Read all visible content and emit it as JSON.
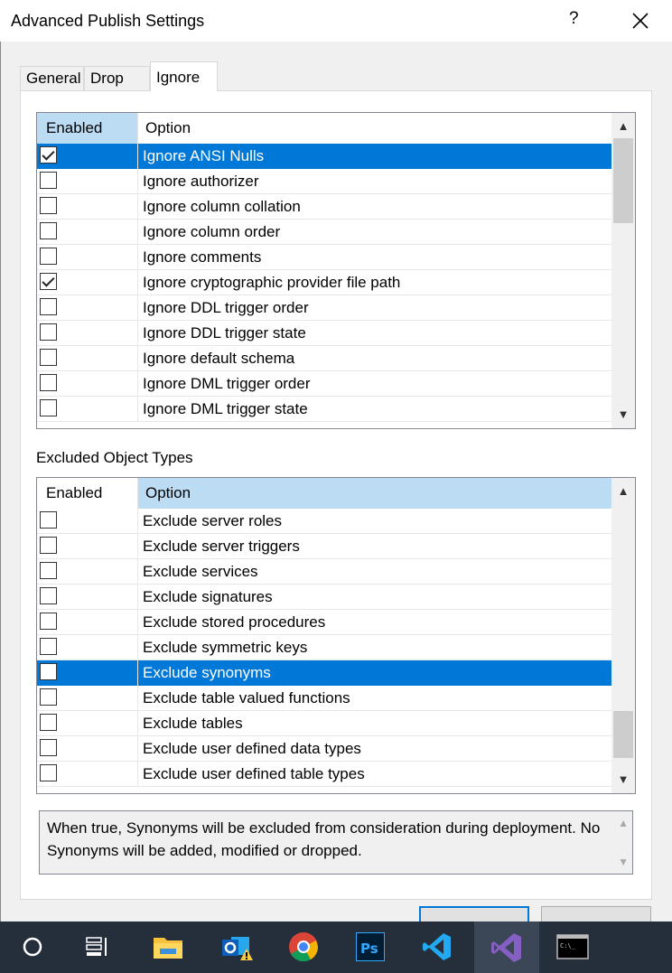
{
  "window": {
    "title": "Advanced Publish Settings",
    "help_label": "?"
  },
  "tabs": [
    {
      "label": "General",
      "active": false
    },
    {
      "label": "Drop",
      "active": false
    },
    {
      "label": "Ignore",
      "active": true
    }
  ],
  "ignore_grid": {
    "headers": {
      "enabled": "Enabled",
      "option": "Option"
    },
    "rows": [
      {
        "label": "Ignore ANSI Nulls",
        "checked": true,
        "selected": true
      },
      {
        "label": "Ignore authorizer",
        "checked": false
      },
      {
        "label": "Ignore column collation",
        "checked": false
      },
      {
        "label": "Ignore column order",
        "checked": false
      },
      {
        "label": "Ignore comments",
        "checked": false
      },
      {
        "label": "Ignore cryptographic provider file path",
        "checked": true
      },
      {
        "label": "Ignore DDL trigger order",
        "checked": false
      },
      {
        "label": "Ignore DDL trigger state",
        "checked": false
      },
      {
        "label": "Ignore default schema",
        "checked": false
      },
      {
        "label": "Ignore DML trigger order",
        "checked": false
      },
      {
        "label": "Ignore DML trigger state",
        "checked": false
      }
    ]
  },
  "excluded_section": {
    "label": "Excluded Object Types"
  },
  "excluded_grid": {
    "headers": {
      "enabled": "Enabled",
      "option": "Option"
    },
    "rows": [
      {
        "label": "Exclude server roles",
        "checked": false
      },
      {
        "label": "Exclude server triggers",
        "checked": false
      },
      {
        "label": "Exclude services",
        "checked": false
      },
      {
        "label": "Exclude signatures",
        "checked": false
      },
      {
        "label": "Exclude stored procedures",
        "checked": false
      },
      {
        "label": "Exclude symmetric keys",
        "checked": false
      },
      {
        "label": "Exclude synonyms",
        "checked": false,
        "selected": true
      },
      {
        "label": "Exclude table valued functions",
        "checked": false
      },
      {
        "label": "Exclude tables",
        "checked": false
      },
      {
        "label": "Exclude user defined data types",
        "checked": false
      },
      {
        "label": "Exclude user defined table types",
        "checked": false
      }
    ]
  },
  "description": {
    "text": "When true, Synonyms will be excluded from consideration during deployment. No Synonyms will be added, modified or dropped."
  },
  "taskbar": {
    "items": [
      "cortana-icon",
      "task-view-icon",
      "file-explorer-icon",
      "outlook-icon",
      "chrome-icon",
      "photoshop-icon",
      "vscode-icon",
      "visual-studio-icon",
      "command-prompt-icon"
    ],
    "colors": {
      "background": "#252e3b",
      "selection": "#0078d7"
    }
  }
}
